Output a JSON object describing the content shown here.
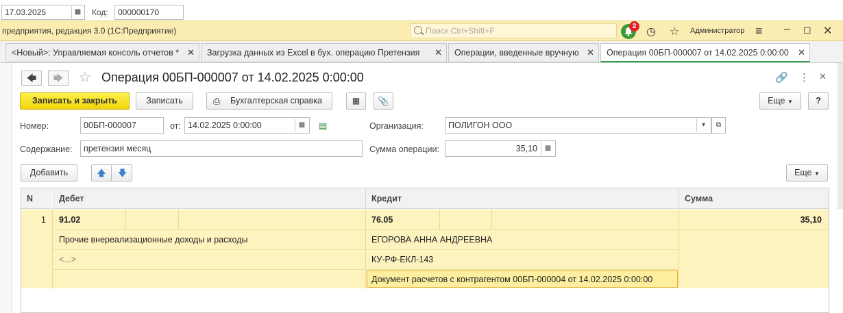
{
  "background": {
    "date_value": "17.03.2025",
    "kod_label": "Код:",
    "kod_value": "000000170"
  },
  "titlebar": {
    "app_title": "предприятия, редакция 3.0  (1С:Предприятие)",
    "search_placeholder": "Поиск Ctrl+Shift+F",
    "notifications_count": "2",
    "user": "Администратор"
  },
  "tabs": [
    {
      "label": "<Новый>: Управляемая консоль отчетов *"
    },
    {
      "label": "Загрузка данных из Excel в бух. операцию Претензия"
    },
    {
      "label": "Операции, введенные вручную"
    },
    {
      "label": "Операция 00БП-000007 от 14.02.2025 0:00:00"
    }
  ],
  "form": {
    "title": "Операция 00БП-000007 от 14.02.2025 0:00:00",
    "buttons": {
      "save_close": "Записать и закрыть",
      "save": "Записать",
      "report": "Бухгалтерская справка",
      "more": "Еще",
      "help": "?"
    },
    "fields": {
      "number_label": "Номер:",
      "number_value": "00БП-000007",
      "date_label": "от:",
      "date_value": "14.02.2025  0:00:00",
      "org_label": "Организация:",
      "org_value": "ПОЛИГОН ООО",
      "content_label": "Содержание:",
      "content_value": "претензия месяц",
      "sum_label": "Сумма операции:",
      "sum_value": "35,10"
    },
    "table_toolbar": {
      "add": "Добавить",
      "more": "Еще"
    },
    "table": {
      "headers": {
        "n": "N",
        "debit": "Дебет",
        "credit": "Кредит",
        "sum": "Сумма"
      },
      "rows": [
        {
          "n": "1",
          "debit_account": "91.02",
          "debit_subconto1": "Прочие внереализационные доходы и расходы",
          "debit_subconto2": "<...>",
          "credit_account": "76.05",
          "credit_subconto1": "ЕГОРОВА АННА АНДРЕЕВНА",
          "credit_subconto2": "КУ-РФ-ЕКЛ-143",
          "credit_subconto3": "Документ расчетов с контрагентом 00БП-000004 от 14.02.2025 0:00:00",
          "sum": "35,10"
        }
      ]
    }
  }
}
